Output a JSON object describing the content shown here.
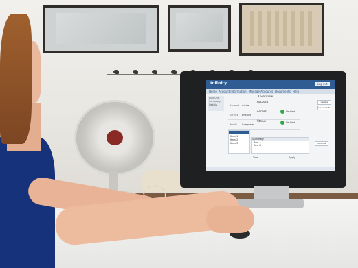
{
  "screen_ui": {
    "brand": "Infinity",
    "login_button": "Log out",
    "nav": [
      "Home",
      "Account Information",
      "Manage Accounts",
      "Documents",
      "Help"
    ],
    "sidebar": [
      "Account",
      "Summary",
      "Details"
    ],
    "page_title": "Overview",
    "cards": [
      {
        "title": "Account",
        "label": "Account",
        "value": "Active"
      },
      {
        "title": "Access",
        "label": "Service",
        "value": "Enabled"
      },
      {
        "title": "Status",
        "label": "Profile",
        "value": "Complete"
      }
    ],
    "status_labels": [
      "Verified",
      "Verified"
    ],
    "right_buttons": [
      "Update",
      "Update Info",
      "Continue"
    ],
    "list_items": [
      "Item 1",
      "Item 2",
      "Item 3"
    ],
    "table_header": "Summary",
    "table_rows": [
      "Row A",
      "Row B"
    ],
    "footer_left": "Total",
    "footer_right": "Apply"
  },
  "colors": {
    "screen_header": "#2f5d93",
    "success": "#2ea84a",
    "shirt": "#16327a"
  }
}
